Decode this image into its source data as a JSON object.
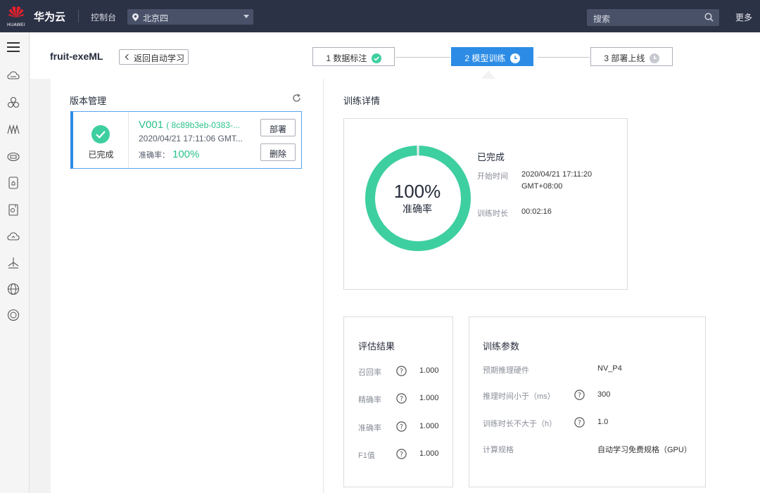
{
  "topbar": {
    "logo_text": "HUAWEI",
    "brand": "华为云",
    "console": "控制台",
    "region": "北京四",
    "search_placeholder": "搜索",
    "more": "更多"
  },
  "sidebar": {
    "icons": [
      "menu-icon",
      "cloud-icon",
      "cluster-icon",
      "ai-icon",
      "cloud-server-icon",
      "storage-icon",
      "database-icon",
      "cloud-upload-icon",
      "network-icon",
      "globe-icon",
      "ip-icon"
    ]
  },
  "header": {
    "title": "fruit-exeML",
    "back_label": "返回自动学习",
    "steps": [
      {
        "label": "1 数据标注",
        "state": "done"
      },
      {
        "label": "2 模型训练",
        "state": "active"
      },
      {
        "label": "3 部署上线",
        "state": "pending"
      }
    ]
  },
  "versions": {
    "title": "版本管理",
    "items": [
      {
        "name": "V001",
        "id": "( 8c89b3eb-0383-...",
        "time": "2020/04/21 17:11:06 GMT...",
        "status": "已完成",
        "acc_label": "准确率：",
        "acc_value": "100%",
        "deploy_label": "部署",
        "delete_label": "删除"
      }
    ]
  },
  "detail": {
    "title": "训练详情",
    "status": "已完成",
    "start_label": "开始时间",
    "start_value_line1": "2020/04/21 17:11:20",
    "start_value_line2": "GMT+08:00",
    "duration_label": "训练时长",
    "duration_value": "00:02:16"
  },
  "chart_data": {
    "type": "pie",
    "style": "donut",
    "center_value": "100%",
    "center_label": "准确率",
    "values": [
      100
    ],
    "max": 100,
    "color": "#3ecfa0"
  },
  "eval": {
    "title": "评估结果",
    "rows": [
      {
        "label": "召回率",
        "value": "1.000"
      },
      {
        "label": "精确率",
        "value": "1.000"
      },
      {
        "label": "准确率",
        "value": "1.000"
      },
      {
        "label": "F1值",
        "value": "1.000"
      }
    ]
  },
  "params": {
    "title": "训练参数",
    "rows": [
      {
        "label": "预期推理硬件",
        "value": "NV_P4",
        "help": false
      },
      {
        "label": "推理时间小于（ms）",
        "value": "300",
        "help": true
      },
      {
        "label": "训练时长不大于（h）",
        "value": "1.0",
        "help": true
      },
      {
        "label": "计算规格",
        "value": "自动学习免费规格（GPU）",
        "help": false
      }
    ]
  },
  "colors": {
    "accent": "#2c8ce5",
    "success": "#2bc28b",
    "topbar": "#2c3246"
  }
}
